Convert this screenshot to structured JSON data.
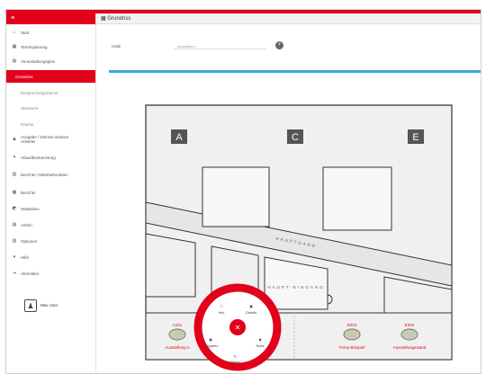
{
  "app": {
    "logo": "≡"
  },
  "sidebar": {
    "items": [
      {
        "label": "Start",
        "icon": "home-icon",
        "glyph": "⌂",
        "active": false,
        "sub": false
      },
      {
        "label": "Terminplanung",
        "icon": "calendar-icon",
        "glyph": "▦",
        "active": false,
        "sub": false
      },
      {
        "label": "Veranstaltungsplan",
        "icon": "list-icon",
        "glyph": "▤",
        "active": false,
        "sub": false
      },
      {
        "label": "Grundriss",
        "icon": "",
        "glyph": "",
        "active": true,
        "sub": false
      },
      {
        "label": "Besprechungsräume",
        "icon": "",
        "glyph": "",
        "active": false,
        "sub": true
      },
      {
        "label": "Standorte",
        "icon": "",
        "glyph": "",
        "active": false,
        "sub": true
      },
      {
        "label": "Räume",
        "icon": "",
        "glyph": "",
        "active": false,
        "sub": true
      },
      {
        "label": "Ausgabe / Dienste anderer Anbieter",
        "icon": "person-icon",
        "glyph": "♟",
        "active": false,
        "sub": false
      },
      {
        "label": "Ablaufbeobachtung",
        "icon": "arrow-down-icon",
        "glyph": "▾",
        "active": false,
        "sub": false
      },
      {
        "label": "Berichte / Mitarbeiterdaten",
        "icon": "chart-icon",
        "glyph": "▥",
        "active": false,
        "sub": false
      },
      {
        "label": "Berichte",
        "icon": "table-icon",
        "glyph": "▦",
        "active": false,
        "sub": false
      },
      {
        "label": "Statistiken",
        "icon": "stats-icon",
        "glyph": "◩",
        "active": false,
        "sub": false
      },
      {
        "label": "Admin",
        "icon": "admin-icon",
        "glyph": "▤",
        "active": false,
        "sub": false
      },
      {
        "label": "Optionen",
        "icon": "options-icon",
        "glyph": "▥",
        "active": false,
        "sub": false
      },
      {
        "label": "Hilfe",
        "icon": "help-icon",
        "glyph": "▾",
        "active": false,
        "sub": false
      },
      {
        "label": "Abmelden",
        "icon": "logout-icon",
        "glyph": "⇥",
        "active": false,
        "sub": false
      }
    ],
    "user": {
      "name": "Max User",
      "icon": "user-avatar-icon"
    }
  },
  "header": {
    "title": "Grundriss",
    "icon": "floorplan-icon"
  },
  "filter": {
    "label": "Halle",
    "placeholder": "Auswählen...",
    "button_icon": "plus-icon"
  },
  "floorplan": {
    "halls": [
      "A",
      "C",
      "E"
    ],
    "corridor_label": "HAUPTGANG",
    "entrance_label": "HAUPT-EINGANG",
    "stands": [
      {
        "number": "A101",
        "name": "Ausstellung A"
      },
      {
        "number": "D201",
        "name": "Firma Beispiel"
      },
      {
        "number": "E301",
        "name": "Ausstellungsstand"
      }
    ]
  },
  "radial_menu": {
    "center_icon": "close-icon",
    "items": [
      {
        "label": "Info",
        "icon": "info-icon"
      },
      {
        "label": "Details",
        "icon": "details-icon"
      },
      {
        "label": "Aufgaben",
        "icon": "tasks-icon"
      },
      {
        "label": "Notiz",
        "icon": "note-icon"
      },
      {
        "label": "Status",
        "icon": "status-icon"
      }
    ],
    "accent": "#e2001a"
  },
  "colors": {
    "accent": "#e2001a",
    "divider": "#3aa8d8",
    "plan_fill": "#f0f0f0",
    "hall_badge": "#555555"
  }
}
